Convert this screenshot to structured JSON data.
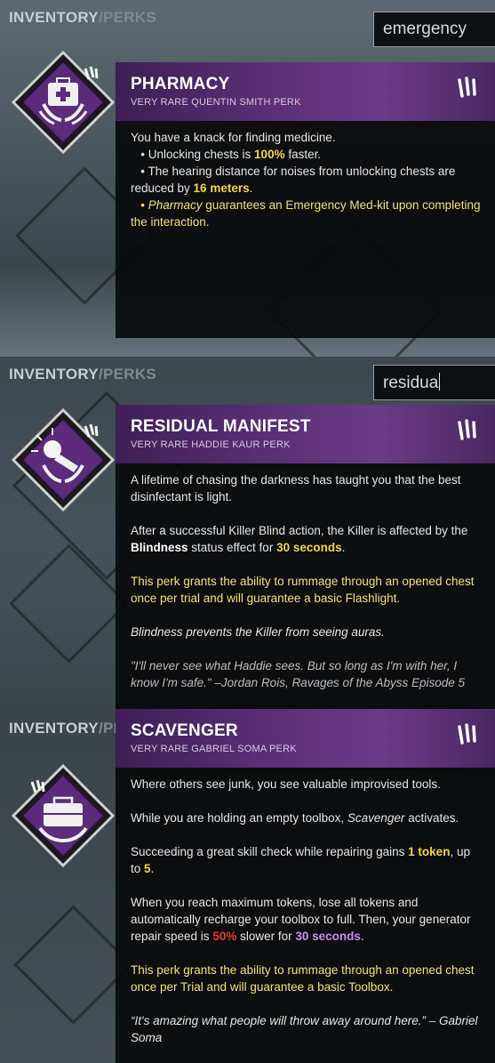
{
  "tabs": {
    "inventory": "INVENTORY",
    "separator": "/",
    "perks": "PERKS"
  },
  "colors": {
    "rare_purple": "#5a2f76",
    "highlight_yellow": "#f2d54a",
    "highlight_red": "#e23a3a",
    "highlight_purple": "#c58ef2"
  },
  "screens": [
    {
      "search_value": "emergency",
      "perk": {
        "icon": "medkit-perk-icon",
        "name": "PHARMACY",
        "subtitle": "VERY RARE QUENTIN SMITH PERK",
        "intro": "You have a knack for finding medicine.",
        "b1_pre": "• Unlocking chests is ",
        "b1_val": "100%",
        "b1_post": " faster.",
        "b2_pre": "• The hearing distance for noises from unlocking chests are reduced by ",
        "b2_val": "16 meters",
        "b2_post": ".",
        "b3_bullet": "• ",
        "b3_name": "Pharmacy",
        "b3_rest": " guarantees an Emergency Med-kit upon completing the interaction."
      }
    },
    {
      "search_value": "residua",
      "perk": {
        "icon": "flashlight-perk-icon",
        "name": "RESIDUAL MANIFEST",
        "subtitle": "VERY RARE HADDIE KAUR PERK",
        "p1": "A lifetime of chasing the darkness has taught you that the best disinfectant is light.",
        "p2_pre": "After a successful Killer Blind action, the Killer is affected by the ",
        "p2_bold": "Blindness",
        "p2_mid": " status effect for ",
        "p2_val": "30 seconds",
        "p2_post": ".",
        "p3": "This perk grants the ability to rummage through an opened chest once per trial and will guarantee a basic Flashlight.",
        "p4": "Blindness prevents the Killer from seeing auras.",
        "quote": "\"I'll never see what Haddie sees. But so long as I'm with her, I know I'm safe.\" –Jordan Rois, Ravages of the Abyss Episode 5"
      }
    },
    {
      "search_value": "",
      "perk": {
        "icon": "toolbox-perk-icon",
        "name": "SCAVENGER",
        "subtitle": "VERY RARE GABRIEL SOMA PERK",
        "p1": "Where others see junk, you see valuable improvised tools.",
        "p2_pre": "While you are holding an empty toolbox, ",
        "p2_it": "Scavenger",
        "p2_post": " activates.",
        "p3_pre": "Succeeding a great skill check while repairing gains ",
        "p3_val": "1 token",
        "p3_mid": ", up to ",
        "p3_max": "5",
        "p3_post": ".",
        "p4_pre": "When you reach maximum tokens, lose all tokens and automatically recharge your toolbox to full. Then, your generator repair speed is ",
        "p4_pct": "50%",
        "p4_mid": " slower for ",
        "p4_val": "30 seconds",
        "p4_post": ".",
        "p5": "This perk grants the ability to rummage through an opened chest once per Trial and will guarantee a basic Toolbox.",
        "quote": "“It's amazing what people will throw away around here.” – Gabriel Soma"
      }
    }
  ]
}
